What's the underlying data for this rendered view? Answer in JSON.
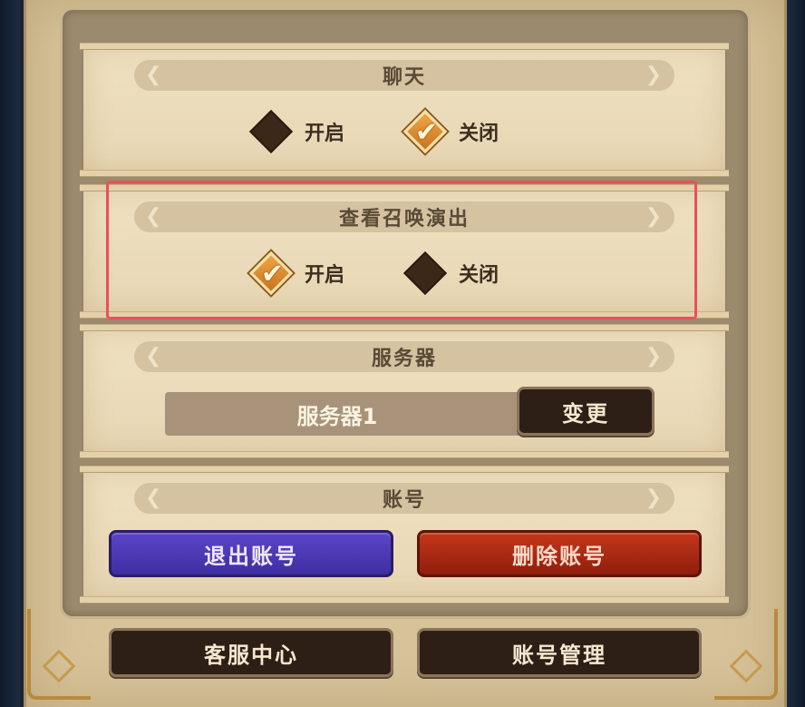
{
  "sections": {
    "chat": {
      "title": "聊天",
      "option_on": "开启",
      "option_off": "关闭",
      "selected": "关闭"
    },
    "summon": {
      "title": "查看召唤演出",
      "option_on": "开启",
      "option_off": "关闭",
      "selected": "开启"
    },
    "server": {
      "title": "服务器",
      "current": "服务器1",
      "change_label": "变更"
    },
    "account": {
      "title": "账号",
      "logout_label": "退出账号",
      "delete_label": "删除账号"
    }
  },
  "footer": {
    "support_label": "客服中心",
    "manage_label": "账号管理"
  },
  "icons": {
    "checked": "checkmark-diamond-icon",
    "unchecked": "diamond-icon",
    "flourish": "ornament-icon"
  },
  "colors": {
    "highlight": "#e8515a",
    "purple_button": "#4a37b3",
    "red_button": "#b02c15",
    "dark_button": "#2e1f16",
    "checked_orange": "#e28f33"
  }
}
